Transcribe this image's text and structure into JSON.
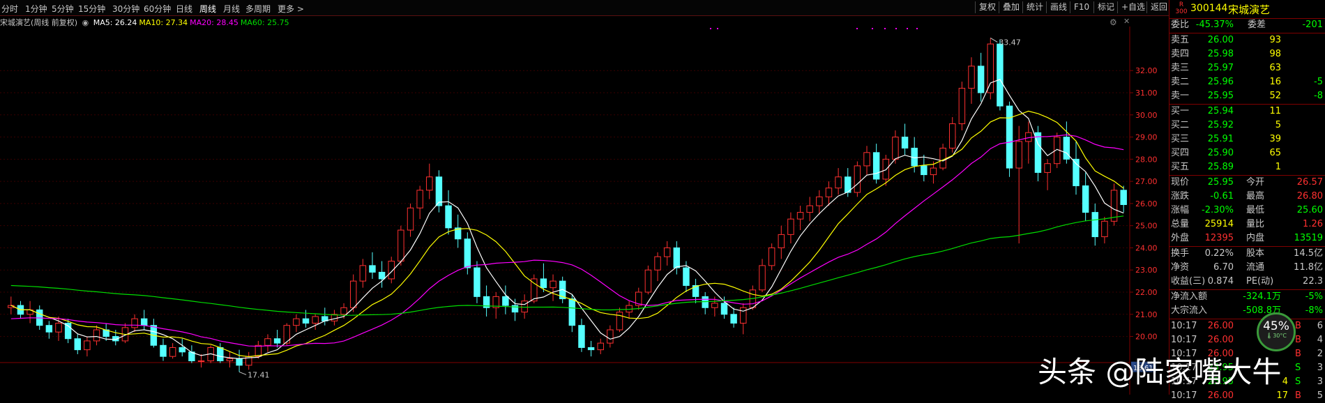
{
  "periods": [
    "分时",
    "1分钟",
    "5分钟",
    "15分钟",
    "30分钟",
    "60分钟",
    "日线",
    "周线",
    "月线",
    "多周期",
    "更多 >"
  ],
  "active_period": "周线",
  "tools": [
    "复权",
    "叠加",
    "统计",
    "画线",
    "F10",
    "标记",
    "+自选",
    "返回"
  ],
  "stock": {
    "code": "300144",
    "name": "宋城演艺",
    "logo_r": "R",
    "logo_n": "300"
  },
  "chart_title": "宋城演艺(周线 前复权)",
  "ma_legend": [
    {
      "label": "MA5: 26.24",
      "color": "#ffffff"
    },
    {
      "label": "MA10: 27.34",
      "color": "#ffff00"
    },
    {
      "label": "MA20: 28.45",
      "color": "#ff00ff"
    },
    {
      "label": "MA60: 25.75",
      "color": "#00dd00"
    }
  ],
  "y_ticks": [
    "32.00",
    "31.00",
    "30.00",
    "29.00",
    "28.00",
    "27.00",
    "26.00",
    "25.00",
    "24.00",
    "23.00",
    "22.00",
    "21.00",
    "20.00"
  ],
  "price_annotations": {
    "high": "33.47",
    "low": "17.41",
    "current_tag": "18.61"
  },
  "order_book": {
    "weibi_label": "委比",
    "weibi": "-45.37%",
    "weicha_label": "委差",
    "weicha": "-201",
    "sell": [
      {
        "label": "卖五",
        "price": "26.00",
        "vol": "93",
        "chg": ""
      },
      {
        "label": "卖四",
        "price": "25.98",
        "vol": "98",
        "chg": ""
      },
      {
        "label": "卖三",
        "price": "25.97",
        "vol": "63",
        "chg": ""
      },
      {
        "label": "卖二",
        "price": "25.96",
        "vol": "16",
        "chg": "-5"
      },
      {
        "label": "卖一",
        "price": "25.95",
        "vol": "52",
        "chg": "-8"
      }
    ],
    "buy": [
      {
        "label": "买一",
        "price": "25.94",
        "vol": "11"
      },
      {
        "label": "买二",
        "price": "25.92",
        "vol": "5"
      },
      {
        "label": "买三",
        "price": "25.91",
        "vol": "39"
      },
      {
        "label": "买四",
        "price": "25.90",
        "vol": "65"
      },
      {
        "label": "买五",
        "price": "25.89",
        "vol": "1"
      }
    ]
  },
  "quote": [
    {
      "l1": "现价",
      "v1": "25.95",
      "c1": "#00ff00",
      "l2": "今开",
      "v2": "26.57",
      "c2": "#ff3030"
    },
    {
      "l1": "涨跌",
      "v1": "-0.61",
      "c1": "#00ff00",
      "l2": "最高",
      "v2": "26.80",
      "c2": "#ff3030"
    },
    {
      "l1": "涨幅",
      "v1": "-2.30%",
      "c1": "#00ff00",
      "l2": "最低",
      "v2": "25.60",
      "c2": "#00ff00"
    },
    {
      "l1": "总量",
      "v1": "25914",
      "c1": "#ffff00",
      "l2": "量比",
      "v2": "1.26",
      "c2": "#ff3030"
    },
    {
      "l1": "外盘",
      "v1": "12395",
      "c1": "#ff3030",
      "l2": "内盘",
      "v2": "13519",
      "c2": "#00ff00"
    }
  ],
  "stats": [
    {
      "l1": "换手",
      "v1": "0.22%",
      "l2": "股本",
      "v2": "14.5亿"
    },
    {
      "l1": "净资",
      "v1": "6.70",
      "l2": "流通",
      "v2": "11.8亿"
    },
    {
      "l1": "收益(三)",
      "v1": "0.874",
      "l2": "PE(动)",
      "v2": "22.3"
    }
  ],
  "flows": [
    {
      "label": "净流入额",
      "value": "-324.1万",
      "pct": "-5%"
    },
    {
      "label": "大宗流入",
      "value": "-508.8万",
      "pct": "-8%"
    }
  ],
  "ticks": [
    {
      "time": "10:17",
      "price": "26.00",
      "vol": "",
      "side": "B",
      "n": "6"
    },
    {
      "time": "10:17",
      "price": "26.00",
      "vol": "",
      "side": "B",
      "n": "4"
    },
    {
      "time": "10:17",
      "price": "26.00",
      "vol": "",
      "side": "B",
      "n": "2"
    },
    {
      "time": "10:17",
      "price": "25.95",
      "vol": "",
      "side": "S",
      "n": "3"
    },
    {
      "time": "10:17",
      "price": "25.95",
      "vol": "4",
      "side": "S",
      "n": "3"
    },
    {
      "time": "10:17",
      "price": "26.00",
      "vol": "17",
      "side": "B",
      "n": "5"
    }
  ],
  "gauge": {
    "pct": "45%",
    "temp": "30°C"
  },
  "watermark": "头条 @陆家嘴大牛",
  "colors": {
    "up": "#ff3030",
    "down": "#55ffff",
    "ma5": "#ffffff",
    "ma10": "#ffff00",
    "ma20": "#ff00ff",
    "ma60": "#00dd00",
    "border": "#800000"
  },
  "chart_data": {
    "type": "candlestick",
    "title": "宋城演艺(周线 前复权)",
    "ylim": [
      19.2,
      33.8
    ],
    "ohlc": [
      [
        21.3,
        21.8,
        21.0,
        21.4
      ],
      [
        21.4,
        21.6,
        20.8,
        21.0
      ],
      [
        21.0,
        21.6,
        20.6,
        21.2
      ],
      [
        21.2,
        21.4,
        20.3,
        20.5
      ],
      [
        20.5,
        20.7,
        19.9,
        20.2
      ],
      [
        20.2,
        20.9,
        19.8,
        20.6
      ],
      [
        20.6,
        20.8,
        19.7,
        19.9
      ],
      [
        19.9,
        20.1,
        19.2,
        19.4
      ],
      [
        19.4,
        20.0,
        19.1,
        19.8
      ],
      [
        19.8,
        20.5,
        19.6,
        20.3
      ],
      [
        20.3,
        20.6,
        19.8,
        20.0
      ],
      [
        20.0,
        20.3,
        19.6,
        19.8
      ],
      [
        19.8,
        20.6,
        19.7,
        20.4
      ],
      [
        20.4,
        21.0,
        20.2,
        20.8
      ],
      [
        20.8,
        21.2,
        20.3,
        20.5
      ],
      [
        20.5,
        20.8,
        19.5,
        19.6
      ],
      [
        19.6,
        19.9,
        18.9,
        19.1
      ],
      [
        19.1,
        19.7,
        19.0,
        19.5
      ],
      [
        19.5,
        19.9,
        19.1,
        19.3
      ],
      [
        19.3,
        19.6,
        18.8,
        18.9
      ],
      [
        18.9,
        19.2,
        18.6,
        18.9
      ],
      [
        18.9,
        19.6,
        18.8,
        19.5
      ],
      [
        19.5,
        19.7,
        18.8,
        18.9
      ],
      [
        18.9,
        19.3,
        18.6,
        19.0
      ],
      [
        19.0,
        19.4,
        18.4,
        18.7
      ],
      [
        18.7,
        19.3,
        18.5,
        19.1
      ],
      [
        19.1,
        19.8,
        19.0,
        19.6
      ],
      [
        19.6,
        20.1,
        19.3,
        19.9
      ],
      [
        19.9,
        20.3,
        19.5,
        19.7
      ],
      [
        19.7,
        20.6,
        19.6,
        20.5
      ],
      [
        20.5,
        21.0,
        20.2,
        20.8
      ],
      [
        20.8,
        21.2,
        20.4,
        20.6
      ],
      [
        20.6,
        21.0,
        20.3,
        20.9
      ],
      [
        20.9,
        21.3,
        20.5,
        20.7
      ],
      [
        20.7,
        21.2,
        20.5,
        21.0
      ],
      [
        21.0,
        21.5,
        20.8,
        21.3
      ],
      [
        21.3,
        22.8,
        21.1,
        22.5
      ],
      [
        22.5,
        23.5,
        22.2,
        23.2
      ],
      [
        23.2,
        23.8,
        22.6,
        22.9
      ],
      [
        22.9,
        23.4,
        22.2,
        22.6
      ],
      [
        22.6,
        23.6,
        22.4,
        23.4
      ],
      [
        23.4,
        25.0,
        23.2,
        24.8
      ],
      [
        24.8,
        26.0,
        24.5,
        25.8
      ],
      [
        25.8,
        26.8,
        25.3,
        26.6
      ],
      [
        26.6,
        27.8,
        26.2,
        27.2
      ],
      [
        27.2,
        27.5,
        25.6,
        25.9
      ],
      [
        25.9,
        26.6,
        24.6,
        24.9
      ],
      [
        24.9,
        25.5,
        24.0,
        24.4
      ],
      [
        24.4,
        24.7,
        22.8,
        23.1
      ],
      [
        23.1,
        23.4,
        21.5,
        21.8
      ],
      [
        21.8,
        22.3,
        20.9,
        21.3
      ],
      [
        21.3,
        22.0,
        20.8,
        21.8
      ],
      [
        21.8,
        22.3,
        21.0,
        21.4
      ],
      [
        21.4,
        21.7,
        20.7,
        21.1
      ],
      [
        21.1,
        21.9,
        20.8,
        21.6
      ],
      [
        21.6,
        22.8,
        21.5,
        22.6
      ],
      [
        22.6,
        23.3,
        22.0,
        22.2
      ],
      [
        22.2,
        22.8,
        21.6,
        22.5
      ],
      [
        22.5,
        22.7,
        21.5,
        21.7
      ],
      [
        21.7,
        21.9,
        20.2,
        20.5
      ],
      [
        20.5,
        20.8,
        19.3,
        19.5
      ],
      [
        19.5,
        19.8,
        19.1,
        19.4
      ],
      [
        19.4,
        19.9,
        19.2,
        19.7
      ],
      [
        19.7,
        20.5,
        19.5,
        20.3
      ],
      [
        20.3,
        21.3,
        20.2,
        21.1
      ],
      [
        21.1,
        21.6,
        20.8,
        21.4
      ],
      [
        21.4,
        22.2,
        21.2,
        22.0
      ],
      [
        22.0,
        23.2,
        21.9,
        23.0
      ],
      [
        23.0,
        23.8,
        22.5,
        23.6
      ],
      [
        23.6,
        24.3,
        23.2,
        24.0
      ],
      [
        24.0,
        24.3,
        22.8,
        23.1
      ],
      [
        23.1,
        23.4,
        22.0,
        22.3
      ],
      [
        22.3,
        22.6,
        21.5,
        21.8
      ],
      [
        21.8,
        22.0,
        21.0,
        21.3
      ],
      [
        21.3,
        21.8,
        20.9,
        21.5
      ],
      [
        21.5,
        21.8,
        20.8,
        21.0
      ],
      [
        21.0,
        21.3,
        20.4,
        20.6
      ],
      [
        20.6,
        21.5,
        20.1,
        21.3
      ],
      [
        21.3,
        22.3,
        21.2,
        22.1
      ],
      [
        22.1,
        23.5,
        22.0,
        23.2
      ],
      [
        23.2,
        24.2,
        23.0,
        24.0
      ],
      [
        24.0,
        25.0,
        23.5,
        24.6
      ],
      [
        24.6,
        25.6,
        24.2,
        25.3
      ],
      [
        25.3,
        25.9,
        24.8,
        25.6
      ],
      [
        25.6,
        26.3,
        25.2,
        25.9
      ],
      [
        25.9,
        26.6,
        25.5,
        26.3
      ],
      [
        26.3,
        27.0,
        25.9,
        26.7
      ],
      [
        26.7,
        27.6,
        26.4,
        27.2
      ],
      [
        27.2,
        27.6,
        26.3,
        26.5
      ],
      [
        26.5,
        27.9,
        26.3,
        27.7
      ],
      [
        27.7,
        28.6,
        27.3,
        28.3
      ],
      [
        28.3,
        28.7,
        26.9,
        27.1
      ],
      [
        27.1,
        28.2,
        26.8,
        28.0
      ],
      [
        28.0,
        29.3,
        27.8,
        29.0
      ],
      [
        29.0,
        29.6,
        28.2,
        28.5
      ],
      [
        28.5,
        29.0,
        27.4,
        27.7
      ],
      [
        27.7,
        28.2,
        27.0,
        27.3
      ],
      [
        27.3,
        27.9,
        26.9,
        27.6
      ],
      [
        27.6,
        28.7,
        27.5,
        28.5
      ],
      [
        28.5,
        29.9,
        28.3,
        29.6
      ],
      [
        29.6,
        31.5,
        29.3,
        31.2
      ],
      [
        31.2,
        32.6,
        30.5,
        32.2
      ],
      [
        32.2,
        32.8,
        30.6,
        31.0
      ],
      [
        31.0,
        33.47,
        30.7,
        33.2
      ],
      [
        33.2,
        33.4,
        30.2,
        30.4
      ],
      [
        30.4,
        30.6,
        27.2,
        27.6
      ],
      [
        27.6,
        29.5,
        24.2,
        28.8
      ],
      [
        28.8,
        29.7,
        27.8,
        29.2
      ],
      [
        29.2,
        29.5,
        27.0,
        27.4
      ],
      [
        27.4,
        28.0,
        26.6,
        27.8
      ],
      [
        27.8,
        29.2,
        27.6,
        29.0
      ],
      [
        29.0,
        29.7,
        27.8,
        28.0
      ],
      [
        28.0,
        28.8,
        26.4,
        26.8
      ],
      [
        26.8,
        27.4,
        25.2,
        25.6
      ],
      [
        25.6,
        26.0,
        24.1,
        24.5
      ],
      [
        24.5,
        25.4,
        24.2,
        25.2
      ],
      [
        25.2,
        26.9,
        25.0,
        26.6
      ],
      [
        26.6,
        26.8,
        25.6,
        25.95
      ]
    ],
    "ma5_last": 26.24,
    "ma10_last": 27.34,
    "ma20_last": 28.45,
    "ma60_last": 25.75
  }
}
